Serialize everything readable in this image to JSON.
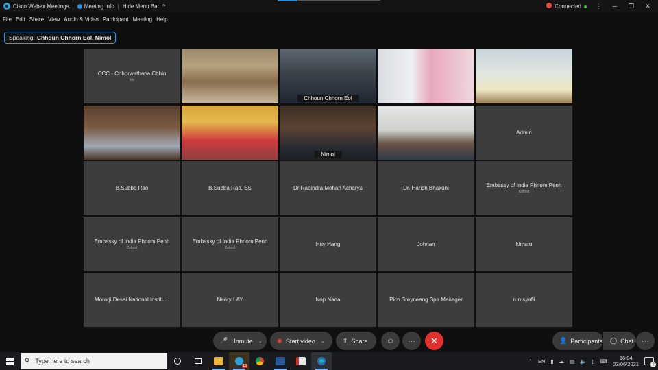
{
  "titlebar": {
    "app_title": "Cisco Webex Meetings",
    "separator": "|",
    "meeting_info": "Meeting Info",
    "hide_menu": "Hide Menu Bar",
    "hide_menu_arrow": "^",
    "status": "Connected",
    "window_controls": [
      "⋮",
      "─",
      "❐",
      "✕"
    ]
  },
  "menubar": [
    "File",
    "Edit",
    "Share",
    "View",
    "Audio & Video",
    "Participant",
    "Meeting",
    "Help"
  ],
  "speaking": {
    "prefix": "Speaking:",
    "names": "Chhoun Chhorn Eol, Nimol"
  },
  "tiles": [
    {
      "name": "CCC - Chhorwathana Chhin",
      "sub": "Me",
      "video": false
    },
    {
      "name": "",
      "sub": "",
      "video": true,
      "scene": "conference-room"
    },
    {
      "name": "Chhoun Chhorn Eol",
      "sub": "",
      "video": true,
      "scene": "man-mask",
      "active": true
    },
    {
      "name": "",
      "sub": "",
      "video": true,
      "scene": "woman-pink"
    },
    {
      "name": "",
      "sub": "",
      "video": true,
      "scene": "man-office"
    },
    {
      "name": "",
      "sub": "",
      "video": true,
      "scene": "man-room"
    },
    {
      "name": "",
      "sub": "",
      "video": true,
      "scene": "woman-red"
    },
    {
      "name": "Nimol",
      "sub": "",
      "video": true,
      "scene": "elder-man",
      "active": true
    },
    {
      "name": "",
      "sub": "",
      "video": true,
      "scene": "young-man"
    },
    {
      "name": "Admin",
      "sub": "",
      "video": false
    },
    {
      "name": "B.Subba Rao",
      "sub": "",
      "video": false
    },
    {
      "name": "B.Subba Rao, SS",
      "sub": "",
      "video": false
    },
    {
      "name": "Dr Rabindra Mohan Acharya",
      "sub": "",
      "video": false
    },
    {
      "name": "Dr. Harish Bhakuni",
      "sub": "",
      "video": false
    },
    {
      "name": "Embassy of India Phnom Penh",
      "sub": "Cohost",
      "video": false
    },
    {
      "name": "Embassy of India Phnom Penh",
      "sub": "Cohost",
      "video": false
    },
    {
      "name": "Embassy of India Phnom Penh",
      "sub": "Cohost",
      "video": false
    },
    {
      "name": "Huy Hang",
      "sub": "",
      "video": false
    },
    {
      "name": "Johnan",
      "sub": "",
      "video": false
    },
    {
      "name": "kimsru",
      "sub": "",
      "video": false
    },
    {
      "name": "Morarji Desai National Institu...",
      "sub": "",
      "video": false
    },
    {
      "name": "Neary LAY",
      "sub": "",
      "video": false
    },
    {
      "name": "Nop Nada",
      "sub": "",
      "video": false
    },
    {
      "name": "Pich Sreyneang Spa Manager",
      "sub": "",
      "video": false
    },
    {
      "name": "run syafii",
      "sub": "",
      "video": false
    }
  ],
  "controls": {
    "unmute": "Unmute",
    "start_video": "Start video",
    "share": "Share",
    "participants": "Participants",
    "chat": "Chat",
    "more": "···"
  },
  "taskbar": {
    "search_placeholder": "Type here to search",
    "lang": "EN",
    "time": "16:04",
    "date": "23/06/2021",
    "telegram_badge": "13",
    "notif_count": "2"
  },
  "colors": {
    "accent": "#4ab8e8",
    "end_call": "#e0312c",
    "tile_bg": "#3d3d3d"
  }
}
